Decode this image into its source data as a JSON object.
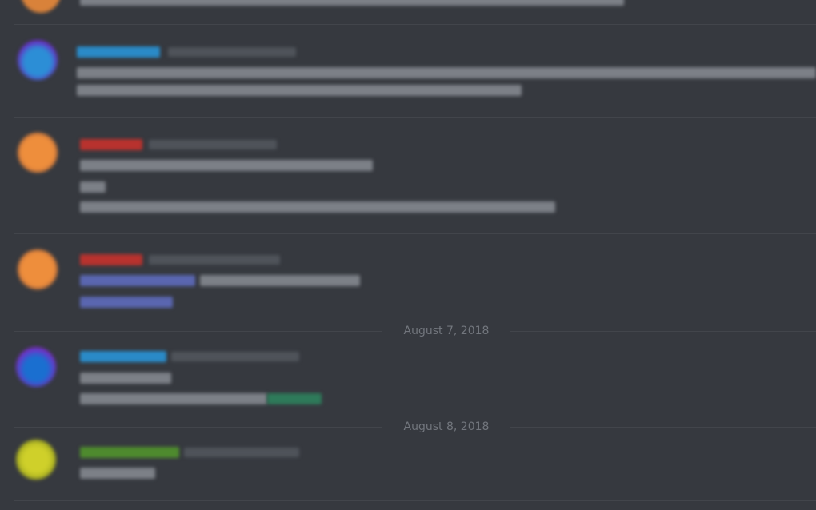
{
  "date_dividers": [
    {
      "label": "August 7, 2018"
    },
    {
      "label": "August 8, 2018"
    }
  ],
  "colors": {
    "background": "#36393f",
    "divider_text": "#72767d",
    "username_blue": "#2a8ac7",
    "username_red": "#b8322e",
    "username_green": "#4e8a2e",
    "mention": "#5a66b0",
    "message_text": "#8e9297",
    "timestamp": "#4f535a"
  }
}
